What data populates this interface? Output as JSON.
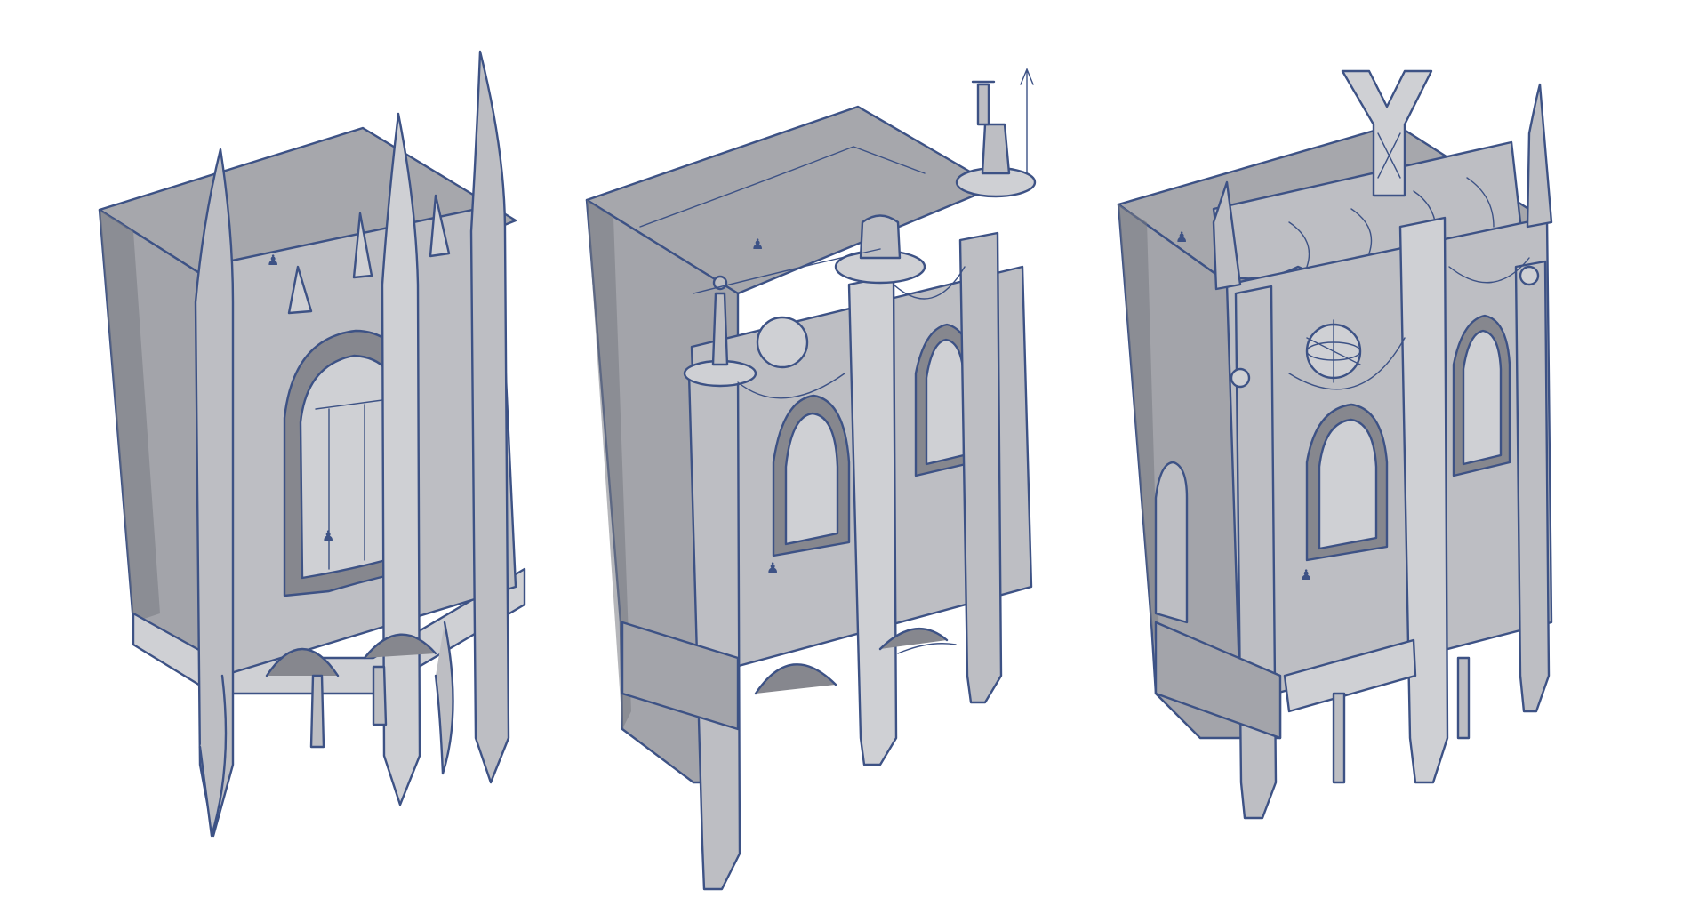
{
  "palette": {
    "background": "#ffffff",
    "line": "#3d5285",
    "top_face": "#a6a7ac",
    "side_face": "#a3a4aa",
    "front_face": "#bdbec3",
    "highlight": "#cfd0d4",
    "shadow": "#86878e"
  },
  "concepts": [
    {
      "variant": "spire-arch",
      "features": [
        "horn-spires",
        "central-arch-window",
        "flared-columns"
      ]
    },
    {
      "variant": "statue-balconies",
      "features": [
        "round-balconies",
        "statues",
        "orb",
        "banner-drapes"
      ]
    },
    {
      "variant": "canopy-orb",
      "features": [
        "draped-canopy",
        "armillary-orb",
        "crest-ornament",
        "slender-legs"
      ]
    }
  ]
}
